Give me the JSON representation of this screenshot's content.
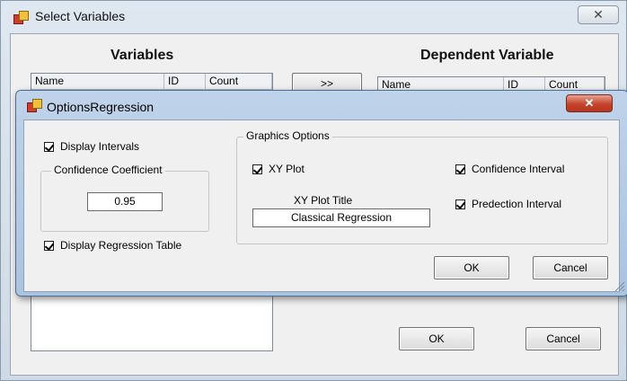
{
  "background_window": {
    "title": "Select Variables",
    "close_glyph": "✕",
    "variables_heading": "Variables",
    "dependent_heading": "Dependent Variable",
    "variables_columns": [
      "Name",
      "ID",
      "Count"
    ],
    "dependent_columns": [
      "Name",
      "ID",
      "Count"
    ],
    "move_button": ">>",
    "ok_button": "OK",
    "cancel_button": "Cancel"
  },
  "dialog": {
    "title": "OptionsRegression",
    "close_glyph": "✕",
    "display_intervals": {
      "label": "Display Intervals",
      "checked": true
    },
    "confidence_coefficient": {
      "label": "Confidence Coefficient",
      "value": "0.95"
    },
    "display_regression_table": {
      "label": "Display Regression Table",
      "checked": true
    },
    "graphics_options": {
      "label": "Graphics Options",
      "xy_plot": {
        "label": "XY Plot",
        "checked": true
      },
      "confidence_interval": {
        "label": "Confidence Interval",
        "checked": true
      },
      "prediction_interval": {
        "label": "Predection Interval",
        "checked": true
      },
      "xy_plot_title": {
        "label": "XY Plot Title",
        "value": "Classical Regression"
      }
    },
    "ok_button": "OK",
    "cancel_button": "Cancel"
  },
  "colors": {
    "dialog_frame": "#aac3df",
    "close_button": "#c4442c",
    "client_area": "#f0f0f0"
  }
}
